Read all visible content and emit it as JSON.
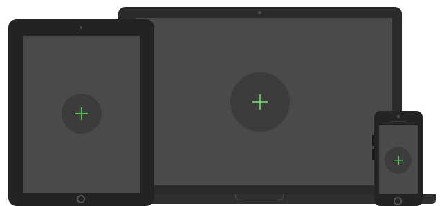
{
  "devices": {
    "laptop": {
      "add_icon": "plus-icon"
    },
    "tablet": {
      "add_icon": "plus-icon"
    },
    "phone": {
      "add_icon": "plus-icon"
    }
  },
  "colors": {
    "accent": "#5cc35c",
    "screen": "#4a4a4a",
    "bezel": "#2b2b2b",
    "button_bg": "#3c3c3c"
  }
}
